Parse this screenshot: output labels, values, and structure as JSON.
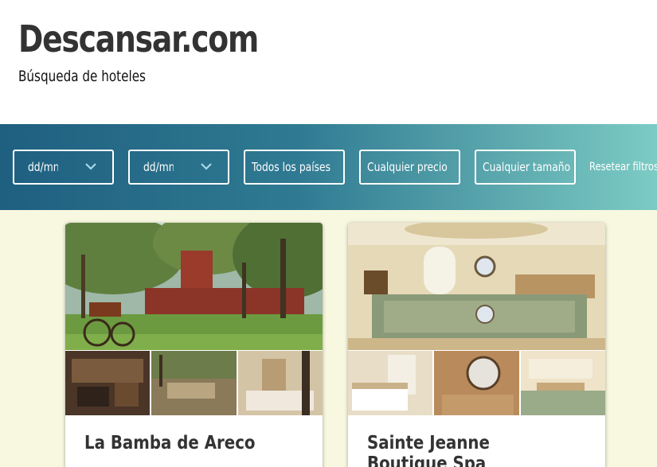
{
  "header": {
    "brand": "Descansar.com",
    "tagline": "Búsqueda de hoteles"
  },
  "filters": {
    "checkin_placeholder": "dd/mm",
    "checkout_placeholder": "dd/mm",
    "country": "Todos los países",
    "price": "Cualquier precio",
    "size": "Cualquier tamaño",
    "reset": "Resetear filtros"
  },
  "hotels": [
    {
      "name": "La Bamba de Areco"
    },
    {
      "name": "Sainte Jeanne Boutique Spa"
    }
  ],
  "colors": {
    "filter_gradient_start": "#1f5f80",
    "filter_gradient_end": "#7ccbc4",
    "content_bg": "#f8f8e0",
    "text_dark": "#333333"
  }
}
